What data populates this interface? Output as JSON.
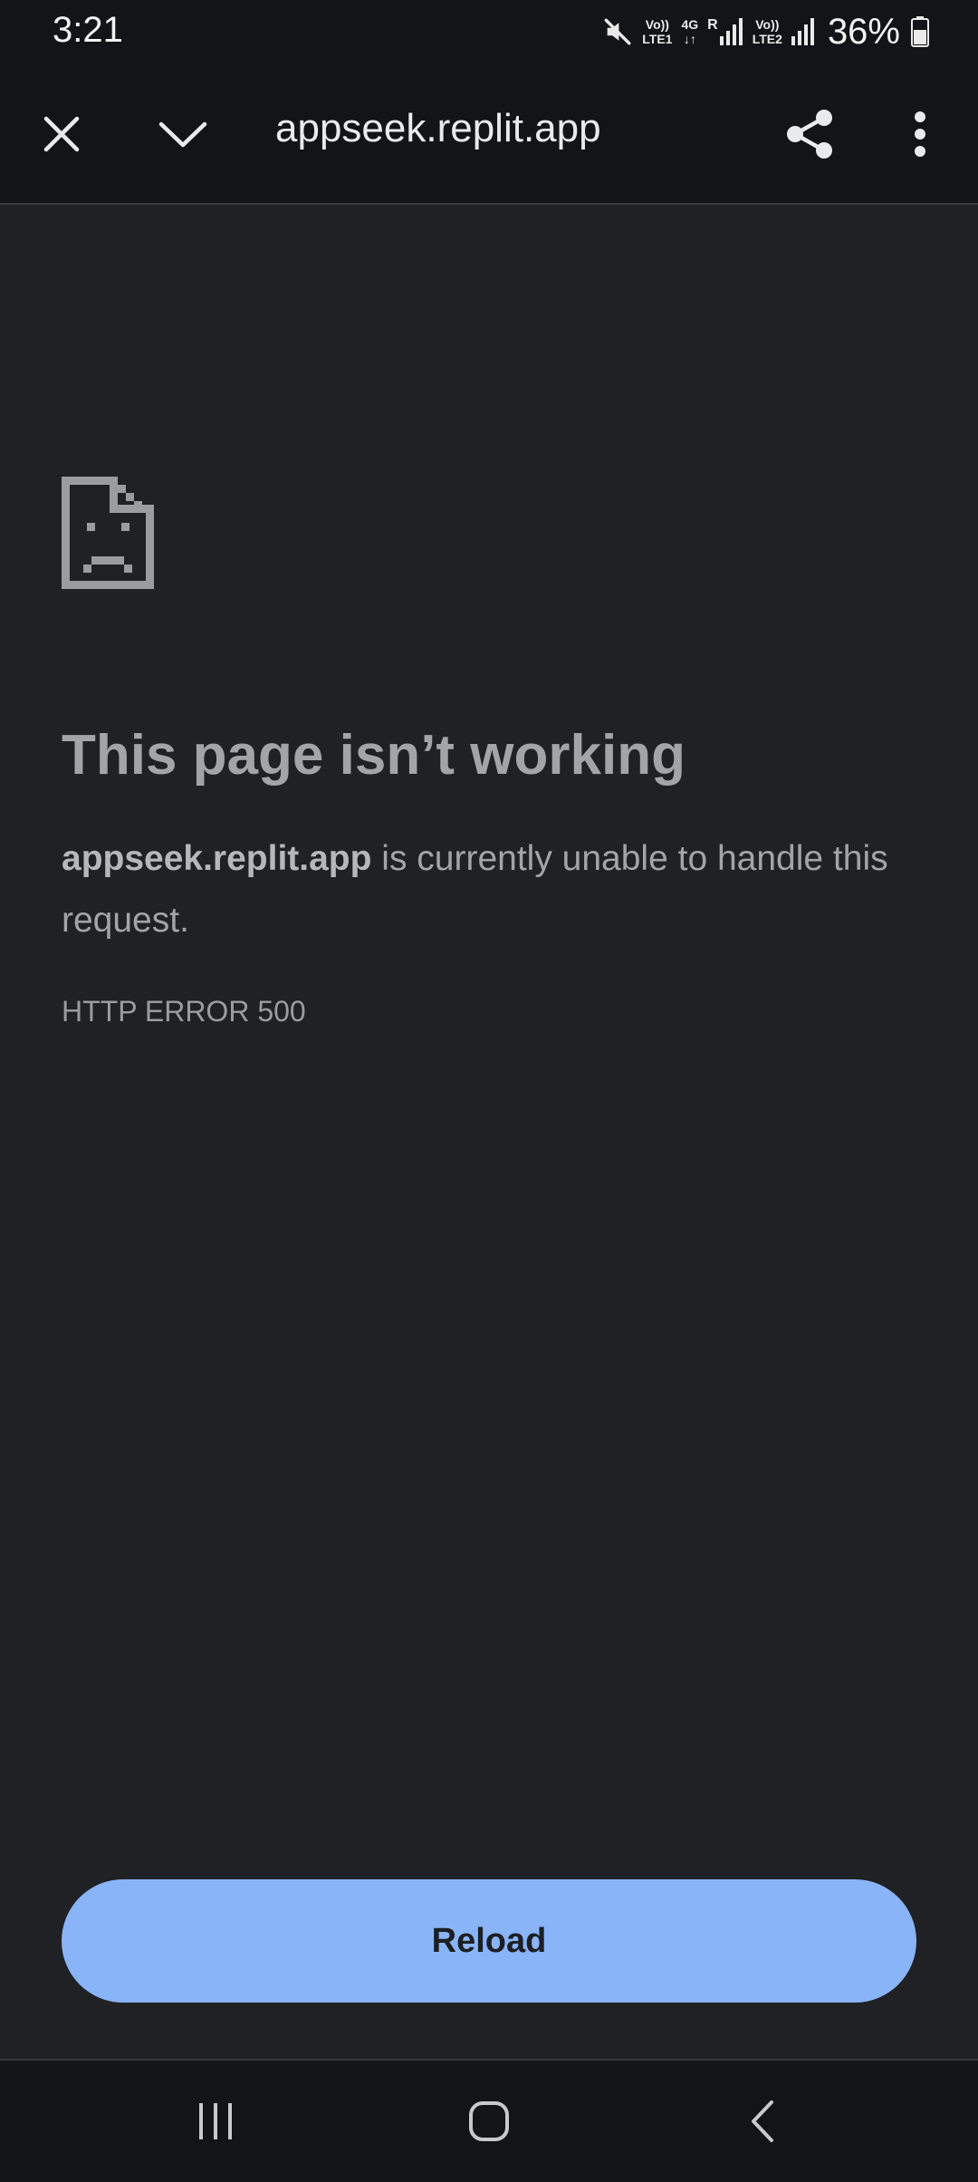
{
  "status_bar": {
    "time": "3:21",
    "battery_percent": "36%",
    "sim1_label_top": "Vo))",
    "sim1_label_bottom": "LTE1",
    "network_type": "4G",
    "roaming_label": "R",
    "sim2_label_top": "Vo))",
    "sim2_label_bottom": "LTE2",
    "icons": [
      "mute-icon",
      "signal-icon",
      "battery-icon"
    ]
  },
  "toolbar": {
    "url": "appseek.replit.app",
    "icons": [
      "close-icon",
      "chevron-down-icon",
      "share-icon",
      "more-vert-icon"
    ]
  },
  "error": {
    "icon": "sad-document-icon",
    "title": "This page isn’t working",
    "host": "appseek.replit.app",
    "message": " is currently unable to handle this request.",
    "code": "HTTP ERROR 500"
  },
  "actions": {
    "reload_label": "Reload"
  },
  "nav_bar": {
    "icons": [
      "recents-icon",
      "home-icon",
      "back-icon"
    ]
  },
  "colors": {
    "background": "#202124",
    "bar_background": "#131417",
    "accent": "#8ab4f8",
    "text_secondary": "#a2a4a8"
  }
}
